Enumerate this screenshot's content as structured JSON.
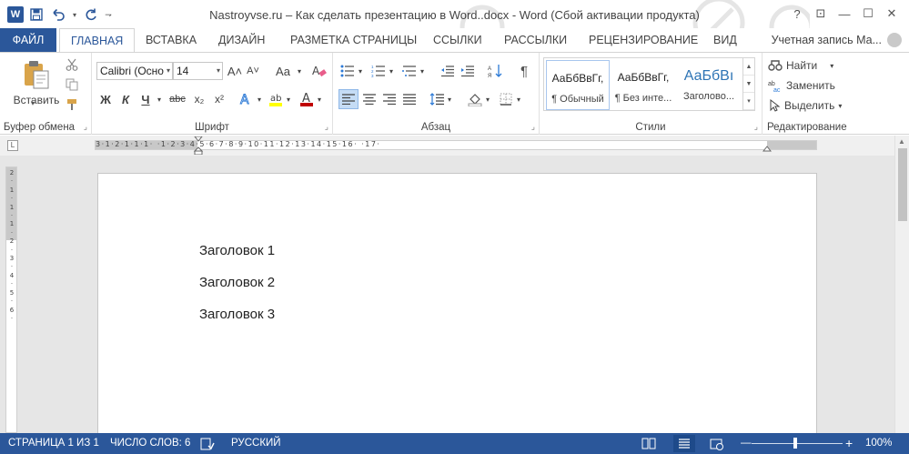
{
  "window": {
    "title": "Nastroyvse.ru – Как сделать презентацию в Word..docx - Word (Сбой активации продукта)"
  },
  "quick_access": {
    "app_icon": "W",
    "save_icon": "save-icon",
    "undo_icon": "undo-icon",
    "redo_icon": "redo-icon"
  },
  "window_controls": [
    "?",
    "⊡",
    "—",
    "☐",
    "✕"
  ],
  "tabs": {
    "file": "ФАЙЛ",
    "items": [
      "ГЛАВНАЯ",
      "ВСТАВКА",
      "ДИЗАЙН",
      "РАЗМЕТКА СТРАНИЦЫ",
      "ССЫЛКИ",
      "РАССЫЛКИ",
      "РЕЦЕНЗИРОВАНИЕ",
      "ВИД"
    ],
    "active": "ГЛАВНАЯ",
    "account": "Учетная запись Ма..."
  },
  "ribbon": {
    "clipboard": {
      "label": "Буфер обмена",
      "paste": "Вставить"
    },
    "font": {
      "label": "Шрифт",
      "font_name": "Calibri (Осно",
      "font_size": "14",
      "grow": "A˄",
      "shrink": "A˅",
      "case": "Aa",
      "bold": "Ж",
      "italic": "К",
      "underline": "Ч",
      "strike": "abc",
      "subscript": "x₂",
      "superscript": "x²"
    },
    "paragraph": {
      "label": "Абзац",
      "pilcrow": "¶"
    },
    "styles": {
      "label": "Стили",
      "items": [
        {
          "sample": "АаБбВвГг,",
          "name": "¶ Обычный"
        },
        {
          "sample": "АаБбВвГг,",
          "name": "¶ Без инте..."
        },
        {
          "sample": "АаБбВı",
          "name": "Заголово..."
        }
      ]
    },
    "editing": {
      "label": "Редактирование",
      "find": "Найти",
      "replace": "Заменить",
      "select": "Выделить"
    }
  },
  "ruler": {
    "horizontal": "3·1·2·1·1·1·  ·1·2·3·4·5·6·7·8·9·10·11·12·13·14·15·16·  ·17·",
    "corner": "L",
    "vertical": [
      "2",
      "·",
      "1",
      "·",
      "1",
      "·",
      "1",
      "·",
      "2",
      "·",
      "3",
      "·",
      "4",
      "·",
      "5",
      "·",
      "6",
      "·"
    ]
  },
  "document": {
    "paragraphs": [
      "Заголовок 1",
      "Заголовок 2",
      "Заголовок 3"
    ]
  },
  "status": {
    "page": "СТРАНИЦА 1 ИЗ 1",
    "words": "ЧИСЛО СЛОВ: 6",
    "language": "РУССКИЙ",
    "zoom": "100%",
    "zoom_fraction": 0.5
  },
  "colors": {
    "accent": "#2b579a",
    "highlight": "#ffff00",
    "font_color": "#c00000"
  }
}
